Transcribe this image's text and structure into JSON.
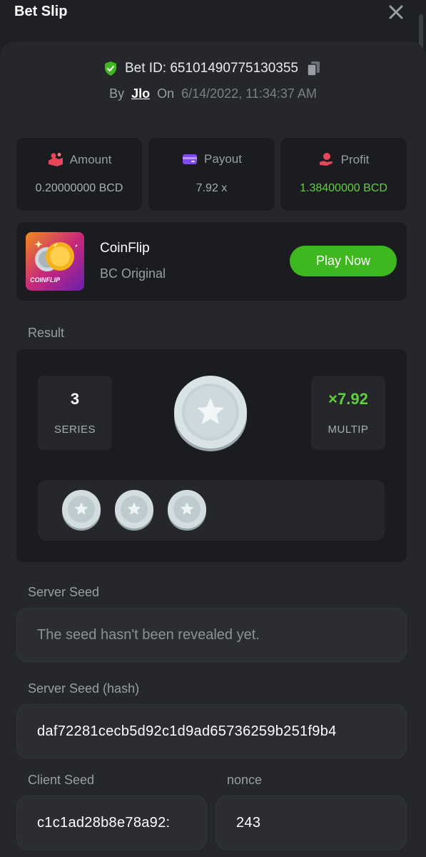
{
  "header": {
    "title": "Bet Slip"
  },
  "bet": {
    "id_label": "Bet ID: 65101490775130355",
    "by_label": "By",
    "user": "Jlo",
    "on_label": "On",
    "datetime": "6/14/2022, 11:34:37 AM"
  },
  "stats": [
    {
      "label": "Amount",
      "value": "0.20000000 BCD",
      "icon": "amount-icon",
      "color": "#e8475b"
    },
    {
      "label": "Payout",
      "value": "7.92 x",
      "icon": "payout-card-icon",
      "color": "#7d4bf0"
    },
    {
      "label": "Profit",
      "value": "1.38400000 BCD",
      "icon": "profit-hand-icon",
      "color": "#e8475b",
      "value_color": "#5fd13c"
    }
  ],
  "game": {
    "name": "CoinFlip",
    "provider": "BC Original",
    "thumb_label": "COINFLIP",
    "play_label": "Play Now"
  },
  "result": {
    "section_label": "Result",
    "series_value": "3",
    "series_label": "SERIES",
    "multiplier_value": "×7.92",
    "multiplier_label": "MULTIP"
  },
  "server_seed": {
    "label": "Server Seed",
    "value": "The seed hasn't been revealed yet."
  },
  "server_seed_hash": {
    "label": "Server Seed (hash)",
    "value": "daf72281cecb5d92c1d9ad65736259b251f9b4"
  },
  "client_seed": {
    "label": "Client Seed",
    "value": "c1c1ad28b8e78a92:"
  },
  "nonce": {
    "label": "nonce",
    "value": "243"
  },
  "colors": {
    "accent_green": "#3fb71e",
    "profit_green": "#5fd13c",
    "verified_shield": "#3fb71e"
  }
}
